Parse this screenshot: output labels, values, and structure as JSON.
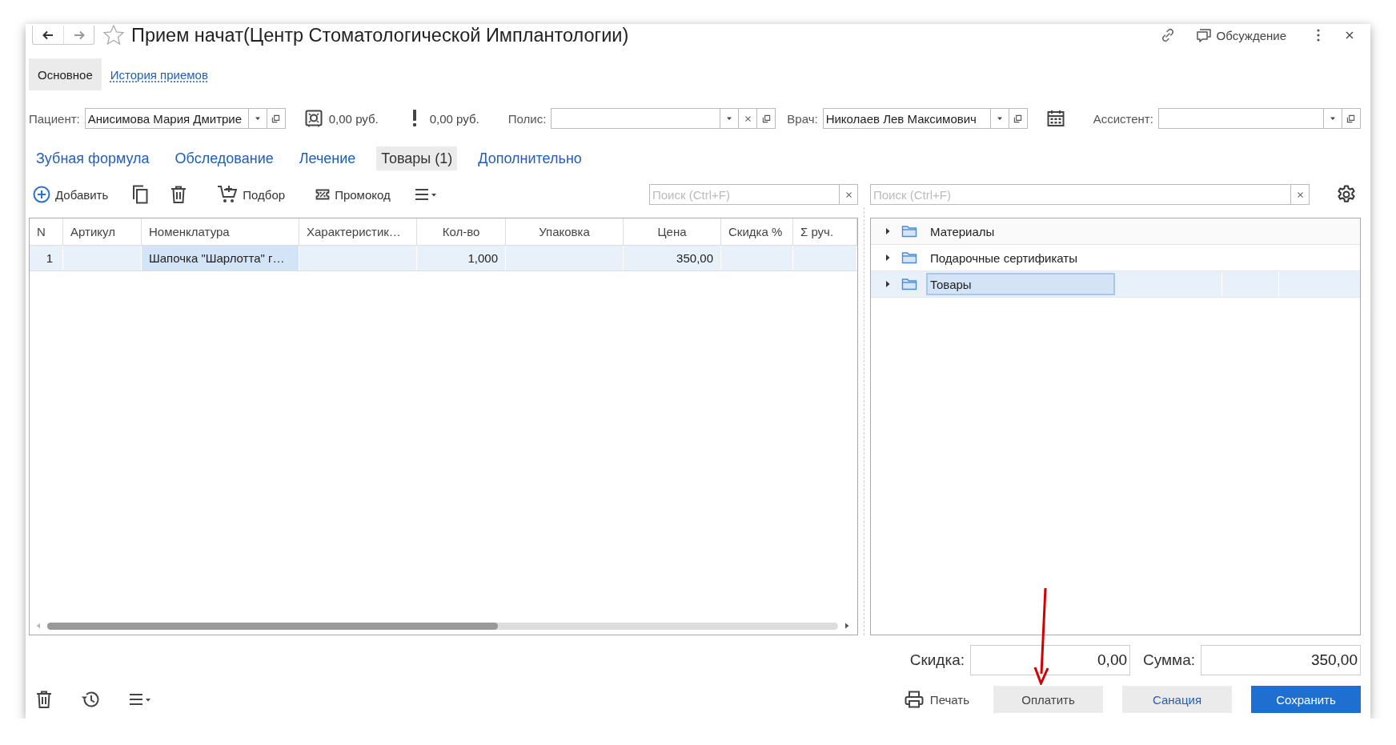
{
  "window": {
    "title": "Прием начат(Центр Стоматологической Имплантологии)"
  },
  "header_actions": {
    "discussion": "Обсуждение"
  },
  "nav_tabs": [
    {
      "label": "Основное",
      "selected": true
    },
    {
      "label": "История приемов",
      "selected": false
    }
  ],
  "patient": {
    "label": "Пациент:",
    "value": "Анисимова Мария Дмитрие"
  },
  "balance": {
    "amount": "0,00",
    "currency": "руб."
  },
  "debt": {
    "amount": "0,00",
    "currency": "руб."
  },
  "policy": {
    "label": "Полис:"
  },
  "doctor": {
    "label": "Врач:",
    "value": "Николаев Лев Максимович"
  },
  "assistant": {
    "label": "Ассистент:"
  },
  "section_tabs": [
    {
      "label": "Зубная формула",
      "selected": false
    },
    {
      "label": "Обследование",
      "selected": false
    },
    {
      "label": "Лечение",
      "selected": false
    },
    {
      "label": "Товары (1)",
      "selected": true
    },
    {
      "label": "Дополнительно",
      "selected": false
    }
  ],
  "toolbar": [
    {
      "kind": "add",
      "label": "Добавить"
    },
    {
      "kind": "copy"
    },
    {
      "kind": "delete"
    },
    {
      "kind": "pick",
      "label": "Подбор"
    },
    {
      "kind": "promo",
      "label": "Промокод"
    },
    {
      "kind": "menu"
    }
  ],
  "table_search": {
    "placeholder": "Поиск (Ctrl+F)"
  },
  "table": {
    "columns": [
      {
        "label": "N",
        "numeric": false
      },
      {
        "label": "Артикул",
        "numeric": false
      },
      {
        "label": "Номенклатура",
        "numeric": false
      },
      {
        "label": "Характеристик…",
        "numeric": false
      },
      {
        "label": "Кол-во",
        "numeric": true
      },
      {
        "label": "Упаковка",
        "numeric": true
      },
      {
        "label": "Цена",
        "numeric": true
      },
      {
        "label": "Скидка %",
        "numeric": false
      },
      {
        "label": "Σ руч.",
        "numeric": false
      }
    ],
    "rows": [
      {
        "selected": true,
        "cells": [
          {
            "text": "1",
            "focused": false
          },
          {
            "focused": false
          },
          {
            "text": "Шапочка \"Шарлотта\" г…",
            "focused": true
          },
          {
            "focused": false
          },
          {
            "text": "1,000",
            "focused": false
          },
          {
            "focused": false
          },
          {
            "text": "350,00",
            "focused": false
          },
          {
            "focused": false
          },
          {
            "focused": false
          }
        ]
      }
    ]
  },
  "tree": {
    "search": {
      "placeholder": "Поиск (Ctrl+F)"
    },
    "items": [
      {
        "label": "Материалы",
        "expanded": false,
        "selected": false
      },
      {
        "label": "Подарочные сертификаты",
        "expanded": false,
        "selected": false
      },
      {
        "label": "Товары",
        "expanded": false,
        "selected": true
      }
    ]
  },
  "totals": [
    {
      "label": "Скидка:",
      "value": "0,00"
    },
    {
      "label": "Сумма:",
      "value": "350,00"
    }
  ],
  "footer_tools": [
    {
      "kind": "delete"
    },
    {
      "kind": "history"
    },
    {
      "kind": "menu"
    }
  ],
  "footer_buttons": [
    {
      "kind": "print",
      "label": "Печать"
    },
    {
      "kind": "default",
      "label": "Оплатить"
    },
    {
      "kind": "link",
      "label": "Санация"
    },
    {
      "kind": "primary",
      "label": "Сохранить"
    }
  ]
}
